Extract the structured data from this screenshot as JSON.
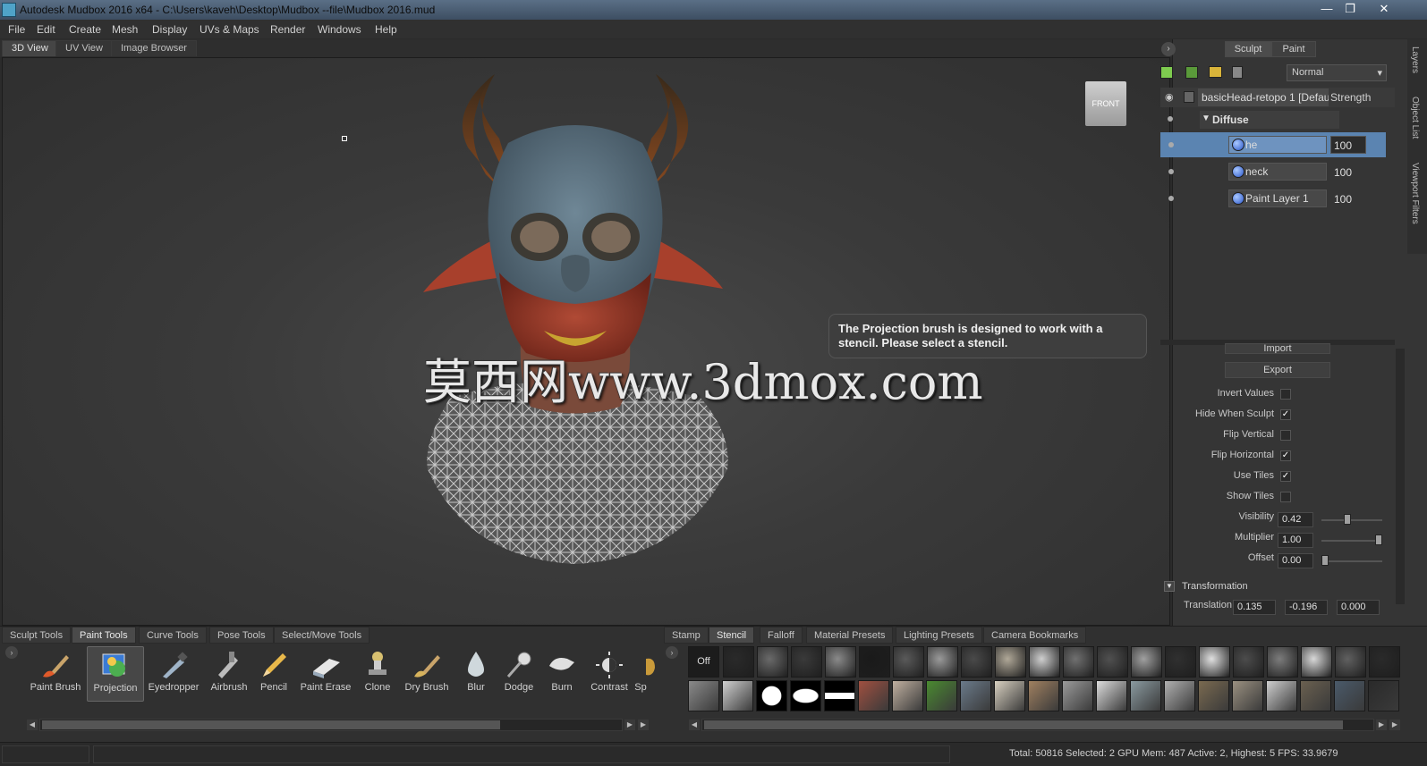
{
  "window": {
    "title": "Autodesk Mudbox 2016 x64 - C:\\Users\\kaveh\\Desktop\\Mudbox --file\\Mudbox 2016.mud"
  },
  "menu": [
    "File",
    "Edit",
    "Create",
    "Mesh",
    "Display",
    "UVs & Maps",
    "Render",
    "Windows",
    "Help"
  ],
  "view_tabs": [
    "3D View",
    "UV View",
    "Image Browser"
  ],
  "viewport": {
    "viewcube_label": "FRONT",
    "tooltip": "The Projection brush is designed to work with a stencil. Please select a stencil.",
    "watermark": "莫西网www.3dmox.com"
  },
  "right_panel": {
    "mode_tabs": [
      "Sculpt",
      "Paint"
    ],
    "blend_mode": "Normal",
    "layer_header": {
      "name": "basicHead-retopo 1 [Defau",
      "column": "Strength"
    },
    "group": "Diffuse",
    "layers": [
      {
        "name": "he",
        "value": "100",
        "selected": true
      },
      {
        "name": "neck",
        "value": "100",
        "selected": false
      },
      {
        "name": "Paint Layer 1",
        "value": "100",
        "selected": false
      }
    ],
    "import_label": "Import",
    "export_label": "Export",
    "options": [
      {
        "label": "Invert Values",
        "checked": false
      },
      {
        "label": "Hide When Sculpt",
        "checked": true
      },
      {
        "label": "Flip Vertical",
        "checked": false
      },
      {
        "label": "Flip Horizontal",
        "checked": true
      },
      {
        "label": "Use Tiles",
        "checked": true
      },
      {
        "label": "Show Tiles",
        "checked": false
      }
    ],
    "sliders": [
      {
        "label": "Visibility",
        "value": "0.42",
        "fraction": 0.42
      },
      {
        "label": "Multiplier",
        "value": "1.00",
        "fraction": 1.0
      },
      {
        "label": "Offset",
        "value": "0.00",
        "fraction": 0.0
      }
    ],
    "transformation": {
      "label": "Transformation",
      "translation_label": "Translation",
      "translation": [
        "0.135",
        "-0.196",
        "0.000"
      ]
    },
    "side_tabs": [
      "Layers",
      "Object List",
      "Viewport Filters"
    ]
  },
  "tool_tabs": [
    "Sculpt Tools",
    "Paint Tools",
    "Curve Tools",
    "Pose Tools",
    "Select/Move Tools"
  ],
  "tools": [
    "Paint Brush",
    "Projection",
    "Eyedropper",
    "Airbrush",
    "Pencil",
    "Paint Erase",
    "Clone",
    "Dry Brush",
    "Blur",
    "Dodge",
    "Burn",
    "Contrast",
    "Sp"
  ],
  "active_tool": "Projection",
  "tray_tabs": [
    "Stamp",
    "Stencil",
    "Falloff",
    "Material Presets",
    "Lighting Presets",
    "Camera Bookmarks"
  ],
  "active_tray_tab": "Stencil",
  "stencil_off_label": "Off",
  "status": "Total: 50816  Selected: 2 GPU Mem: 487  Active: 2, Highest: 5  FPS: 33.9679",
  "colors": {
    "selection": "#5b84b1",
    "accent": "#4fa3c8"
  }
}
